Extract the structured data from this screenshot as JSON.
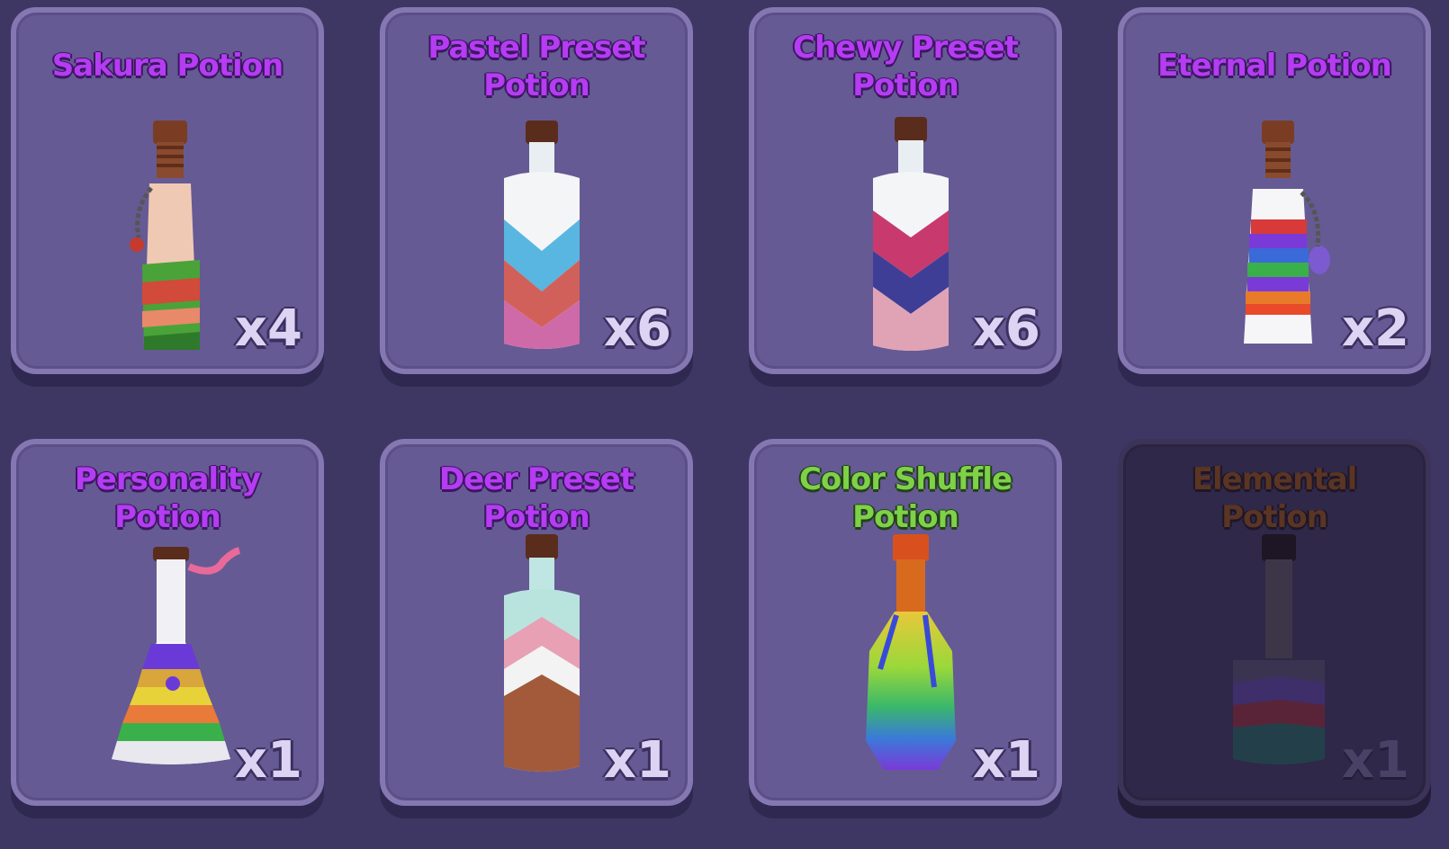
{
  "potions": [
    {
      "name": "Sakura Potion",
      "count": "x4",
      "title_color": "#b53cf2",
      "locked": false
    },
    {
      "name": "Pastel Preset\nPotion",
      "count": "x6",
      "title_color": "#b53cf2",
      "locked": false
    },
    {
      "name": "Chewy Preset\nPotion",
      "count": "x6",
      "title_color": "#b53cf2",
      "locked": false
    },
    {
      "name": "Eternal Potion",
      "count": "x2",
      "title_color": "#b53cf2",
      "locked": false
    },
    {
      "name": "Personality\nPotion",
      "count": "x1",
      "title_color": "#b53cf2",
      "locked": false
    },
    {
      "name": "Deer Preset\nPotion",
      "count": "x1",
      "title_color": "#b53cf2",
      "locked": false
    },
    {
      "name": "Color Shuffle\nPotion",
      "count": "x1",
      "title_color": "#7ed148",
      "locked": false
    },
    {
      "name": "Elemental\nPotion",
      "count": "x1",
      "title_color": "#5a3523",
      "locked": true
    }
  ],
  "icons": [
    "sakura-potion-icon",
    "pastel-potion-icon",
    "chewy-potion-icon",
    "eternal-potion-icon",
    "personality-potion-icon",
    "deer-potion-icon",
    "color-shuffle-potion-icon",
    "elemental-potion-icon"
  ],
  "colors": {
    "background": "#3f3763",
    "card": "#655a94",
    "card_border": "#8477b2",
    "locked_card": "#2f2848"
  }
}
